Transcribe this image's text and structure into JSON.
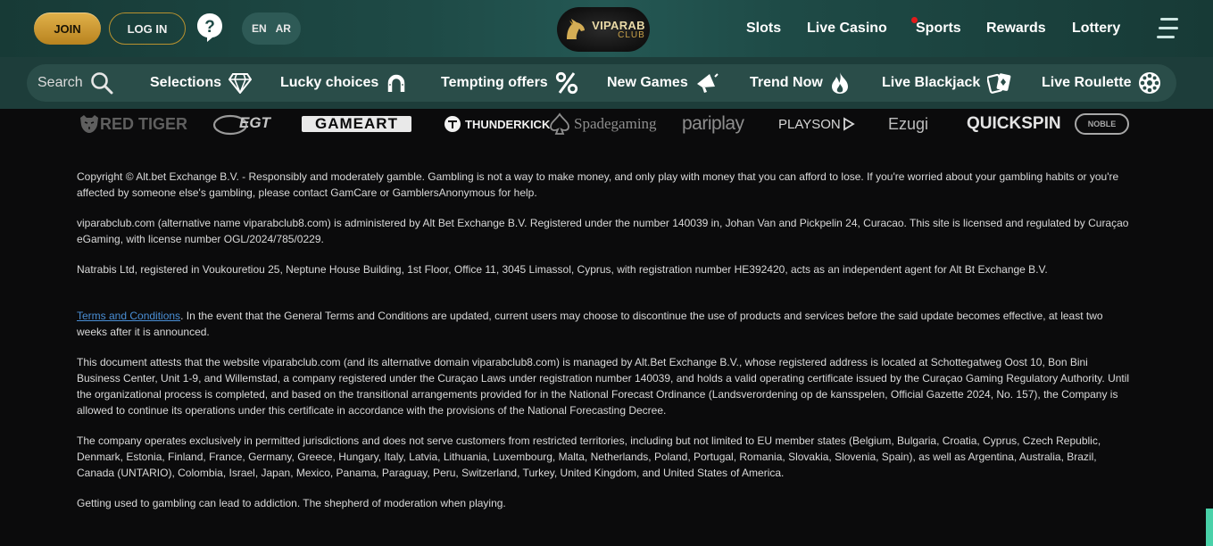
{
  "header": {
    "join_label": "JOIN",
    "login_label": "LOG IN",
    "help_icon": "question-circle-icon",
    "languages": [
      "EN",
      "AR"
    ],
    "logo": {
      "line1": "VIPARAB",
      "line2": "CLUB"
    },
    "nav": [
      {
        "label": "Slots"
      },
      {
        "label": "Live Casino"
      },
      {
        "label": "Sports",
        "badge_color": "#e21b1b"
      },
      {
        "label": "Rewards"
      },
      {
        "label": "Lottery"
      }
    ],
    "menu_icon": "hamburger-menu-icon"
  },
  "categories": {
    "search_label": "Search",
    "items": [
      {
        "label": "Selections",
        "icon": "diamond-icon"
      },
      {
        "label": "Lucky choices",
        "icon": "horseshoe-icon"
      },
      {
        "label": "Tempting offers",
        "icon": "percent-icon"
      },
      {
        "label": "New Games",
        "icon": "megaphone-icon"
      },
      {
        "label": "Trend Now",
        "icon": "flame-icon"
      },
      {
        "label": "Live Blackjack",
        "icon": "playing-cards-icon"
      },
      {
        "label": "Live Roulette",
        "icon": "roulette-wheel-icon"
      }
    ]
  },
  "providers": [
    "RED TIGER",
    "EGT",
    "GAMEART",
    "THUNDERKICK",
    "Spadegaming",
    "pariplay",
    "PLAYSON",
    "Ezugi",
    "QUICKSPIN",
    "NOBLE"
  ],
  "legal": {
    "copyright": "Copyright © Alt.bet Exchange B.V. - Responsibly and moderately gamble. Gambling is not a way to make money, and only play with money that you can afford to lose. If you're worried about your gambling habits or you're affected by someone else's gambling, please contact GamCare or GamblersAnonymous for help.",
    "administered": "viparabclub.com (alternative name viparabclub8.com) is administered by Alt Bet Exchange B.V. Registered under the number 140039 in, Johan Van and Pickpelin 24, Curacao. This site is licensed and regulated by Curaçao eGaming, with license number OGL/2024/785/0229.",
    "agent": "Natrabis Ltd, registered in Voukouretiou 25, Neptune House Building, 1st Floor, Office 11, 3045 Limassol, Cyprus, with registration number HE392420, acts as an independent agent for Alt Bt Exchange B.V.",
    "terms_link": "Terms and Conditions",
    "terms_text": ". In the event that the General Terms and Conditions are updated, current users may choose to discontinue the use of products and services before the said update becomes effective, at least two weeks after it is announced.",
    "attest": "This document attests that the website viparabclub.com (and its alternative domain viparabclub8.com) is managed by Alt.Bet Exchange B.V., whose registered address is located at Schottegatweg Oost 10, Bon Bini Business Center, Unit 1-9, and Willemstad, a company registered under the Curaçao Laws under registration number 140039, and holds a valid operating certificate issued by the Curaçao Gaming Regulatory Authority. Until the organizational process is completed, and based on the transitional arrangements provided for in the National Forecast Ordinance (Landsverordening op de kansspelen, Official Gazette 2024, No. 157), the Company is allowed to continue its operations under this certificate in accordance with the provisions of the National Forecasting Decree.",
    "jurisdictions": "The company operates exclusively in permitted jurisdictions and does not serve customers from restricted territories, including but not limited to EU member states (Belgium, Bulgaria, Croatia, Cyprus, Czech Republic, Denmark, Estonia, Finland, France, Germany, Greece, Hungary, Italy, Latvia, Lithuania, Luxembourg, Malta, Netherlands, Poland, Portugal, Romania, Slovakia, Slovenia, Spain), as well as Argentina, Australia, Brazil, Canada (UNTARIO), Colombia, Israel, Japan, Mexico, Panama, Paraguay, Peru, Switzerland, Turkey, United Kingdom, and United States of America.",
    "moderation": "Getting used to gambling can lead to addiction. The shepherd of moderation when playing."
  },
  "colors": {
    "header_bg": "#1e4a46",
    "category_bar_bg": "#1d3d3a",
    "join_gold": "#d9a63a",
    "link_blue": "#4a8fd6",
    "page_bg": "#0b0b0c"
  }
}
